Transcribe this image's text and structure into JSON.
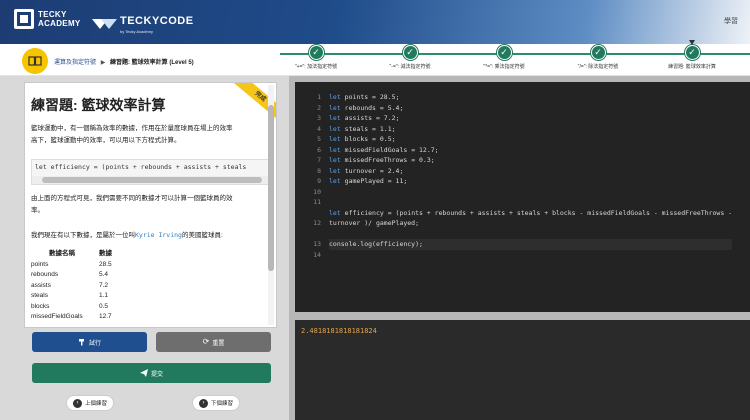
{
  "header": {
    "brand1_line1": "TECKY",
    "brand1_line2": "ACADEMY",
    "brand2_name": "TECKYCODE",
    "brand2_sub": "by Tecky Academy",
    "learn_label": "學習"
  },
  "breadcrumb": {
    "first": "運算及指定符號",
    "current": "練習題: 籃球效率計算 (Level 5)"
  },
  "progress_steps": [
    {
      "label": "\"+=\": 加法指定符號"
    },
    {
      "label": "\"-=\": 減法指定符號"
    },
    {
      "label": "\"*=\": 乘法指定符號"
    },
    {
      "label": "\"/=\": 除法指定符號"
    },
    {
      "label": "練習題: 籃球效率計算"
    }
  ],
  "exercise": {
    "ribbon": "完成",
    "title": "練習題: 籃球效率計算",
    "intro_line1": "籃球運動中，有一個稱為效率的數據，作用在於量度球員在場上的效率",
    "intro_line2": "高下，籃球運動中的效率，可以用以下方程式計算。",
    "formula": "let efficiency = (points + rebounds + assists + steals",
    "para2_line1": "由上面的方程式可見，我們需要不同的數據才可以計算一個籃球員的效",
    "para2_line2": "率。",
    "para3_prefix": "我們現在有以下數據，是屬於一位叫",
    "para3_name": "Kyrie Irving",
    "para3_suffix": "的美國籃球員:",
    "table_headers": [
      "數據名稱",
      "數據"
    ],
    "table_rows": [
      [
        "points",
        "28.5"
      ],
      [
        "rebounds",
        "5.4"
      ],
      [
        "assists",
        "7.2"
      ],
      [
        "steals",
        "1.1"
      ],
      [
        "blocks",
        "0.5"
      ],
      [
        "missedFieldGoals",
        "12.7"
      ]
    ]
  },
  "buttons": {
    "try": "試行",
    "reset": "重置",
    "submit": "提交",
    "prev": "上個練習",
    "next": "下個練習"
  },
  "editor": {
    "line_numbers": [
      "1",
      "2",
      "3",
      "4",
      "5",
      "6",
      "7",
      "8",
      "9",
      "10",
      "11",
      "",
      "12",
      "",
      "13",
      "14"
    ],
    "lines": [
      {
        "kw": "let",
        "rest": " points = 28.5;"
      },
      {
        "kw": "let",
        "rest": " rebounds = 5.4;"
      },
      {
        "kw": "let",
        "rest": " assists = 7.2;"
      },
      {
        "kw": "let",
        "rest": " steals = 1.1;"
      },
      {
        "kw": "let",
        "rest": " blocks = 0.5;"
      },
      {
        "kw": "let",
        "rest": " missedFieldGoals = 12.7;"
      },
      {
        "kw": "let",
        "rest": " missedFreeThrows = 0.3;"
      },
      {
        "kw": "let",
        "rest": " turnover = 2.4;"
      },
      {
        "kw": "let",
        "rest": " gamePlayed = 11;"
      },
      {
        "kw": "",
        "rest": ""
      },
      {
        "kw": "",
        "rest": ""
      },
      {
        "kw": "let",
        "rest": " efficiency = (points + rebounds + assists + steals + blocks - missedFieldGoals - missedFreeThrows -"
      },
      {
        "kw": "",
        "rest": "turnover )/ gamePlayed;"
      },
      {
        "kw": "",
        "rest": ""
      },
      {
        "kw": "",
        "rest": "console.log(efficiency);"
      }
    ],
    "output": "2.4818181818181824"
  },
  "colors": {
    "primary_blue": "#1f4f8f",
    "green": "#227a5e",
    "yellow": "#f6c400"
  }
}
